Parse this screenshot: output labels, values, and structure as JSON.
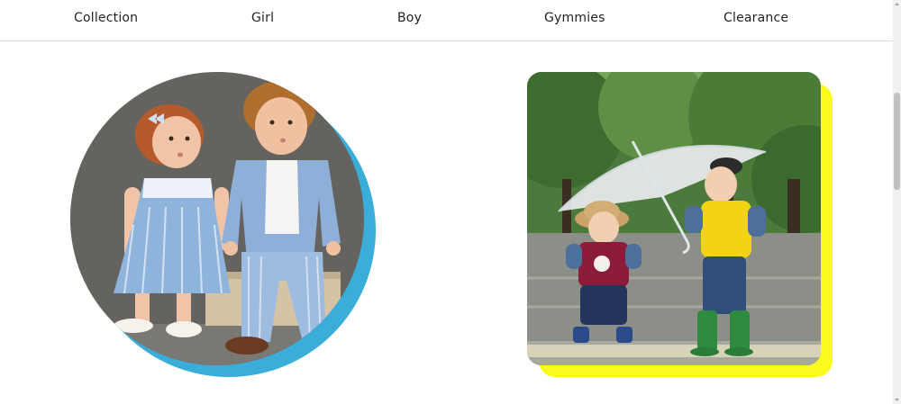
{
  "nav": {
    "items": [
      {
        "label": "Collection"
      },
      {
        "label": "Girl"
      },
      {
        "label": "Boy"
      },
      {
        "label": "Gymmies"
      },
      {
        "label": "Clearance"
      }
    ]
  },
  "colors": {
    "accent_blue": "#3aaed8",
    "accent_yellow": "#fafa1e",
    "nav_border": "#dcdcdc"
  },
  "images": {
    "left": {
      "shape": "circle",
      "subject": "two toddlers sitting on a wooden box"
    },
    "right": {
      "shape": "rounded-square",
      "subject": "two boys under a clear umbrella in a park"
    }
  }
}
